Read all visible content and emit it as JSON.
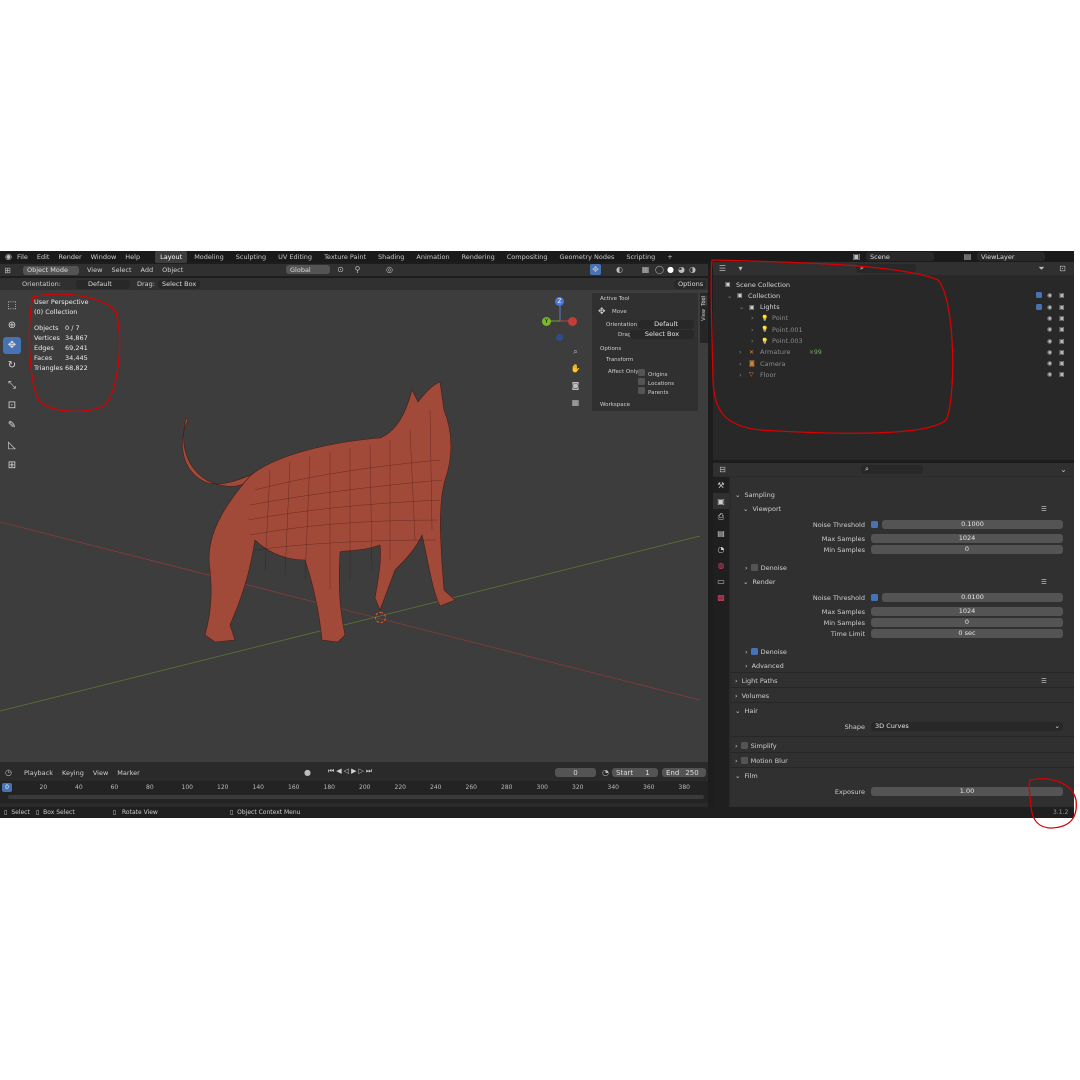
{
  "topbar": {
    "menus": [
      "File",
      "Edit",
      "Render",
      "Window",
      "Help"
    ],
    "workspaces": [
      "Layout",
      "Modeling",
      "Sculpting",
      "UV Editing",
      "Texture Paint",
      "Shading",
      "Animation",
      "Rendering",
      "Compositing",
      "Geometry Nodes",
      "Scripting"
    ],
    "active_workspace": "Layout",
    "add_tab": "+",
    "scene": "Scene",
    "view_layer": "ViewLayer"
  },
  "header": {
    "mode": "Object Mode",
    "menus": [
      "View",
      "Select",
      "Add",
      "Object"
    ],
    "orientation_transform": "Global"
  },
  "tool_settings": {
    "orientation_label": "Orientation:",
    "orientation_value": "Default",
    "drag_label": "Drag:",
    "drag_value": "Select Box",
    "options": "Options"
  },
  "overlay": {
    "title": "User Perspective",
    "collection": "(0) Collection",
    "stats": [
      {
        "k": "Objects",
        "v": "0 / 7"
      },
      {
        "k": "Vertices",
        "v": "34,867"
      },
      {
        "k": "Edges",
        "v": "69,241"
      },
      {
        "k": "Faces",
        "v": "34,445"
      },
      {
        "k": "Triangles",
        "v": "68,822"
      }
    ]
  },
  "gizmo": {
    "z": "Z",
    "y": "Y"
  },
  "npanel": {
    "active_tool": "Active Tool",
    "move": "Move",
    "orientation": "Orientation",
    "orientation_value": "Default",
    "drag": "Drag",
    "drag_value": "Select Box",
    "options": "Options",
    "transform": "Transform",
    "affect_only": "Affect Only",
    "origins": "Origins",
    "locations": "Locations",
    "parents": "Parents",
    "workspace": "Workspace",
    "tabs": [
      "Tool",
      "View"
    ]
  },
  "timeline": {
    "menus": [
      "Playback",
      "Keying",
      "View",
      "Marker"
    ],
    "current_frame": "0",
    "start_label": "Start",
    "start": "1",
    "end_label": "End",
    "end": "250",
    "ticks": [
      "0",
      "20",
      "40",
      "60",
      "80",
      "100",
      "120",
      "140",
      "160",
      "180",
      "200",
      "220",
      "240",
      "260",
      "280",
      "300",
      "320",
      "340",
      "360",
      "380"
    ]
  },
  "status": {
    "select": "Select",
    "box_select": "Box Select",
    "rotate": "Rotate View",
    "context": "Object Context Menu",
    "version": "3.1.2"
  },
  "outliner": {
    "rows": [
      {
        "label": "Scene Collection",
        "indent": 0
      },
      {
        "label": "Collection",
        "indent": 1
      },
      {
        "label": "Lights",
        "indent": 2
      },
      {
        "label": "Point",
        "indent": 3
      },
      {
        "label": "Point.001",
        "indent": 3
      },
      {
        "label": "Point.003",
        "indent": 3
      },
      {
        "label": "Armature",
        "indent": 2,
        "extra": "×99"
      },
      {
        "label": "Camera",
        "indent": 2
      },
      {
        "label": "Floor",
        "indent": 2
      }
    ]
  },
  "properties": {
    "sampling": "Sampling",
    "viewport": "Viewport",
    "noise_threshold": "Noise Threshold",
    "viewport_noise": "0.1000",
    "max_samples": "Max Samples",
    "viewport_max": "1024",
    "min_samples": "Min Samples",
    "viewport_min": "0",
    "denoise": "Denoise",
    "render": "Render",
    "render_noise": "0.0100",
    "render_max": "1024",
    "render_min": "0",
    "time_limit": "Time Limit",
    "time_limit_value": "0 sec",
    "advanced": "Advanced",
    "light_paths": "Light Paths",
    "volumes": "Volumes",
    "hair": "Hair",
    "shape": "Shape",
    "shape_value": "3D Curves",
    "simplify": "Simplify",
    "motion_blur": "Motion Blur",
    "film": "Film",
    "exposure": "Exposure",
    "exposure_value": "1.00"
  },
  "colors": {
    "accent": "#4772b3",
    "annotation": "#d80000",
    "mesh": "#a24a3a"
  }
}
